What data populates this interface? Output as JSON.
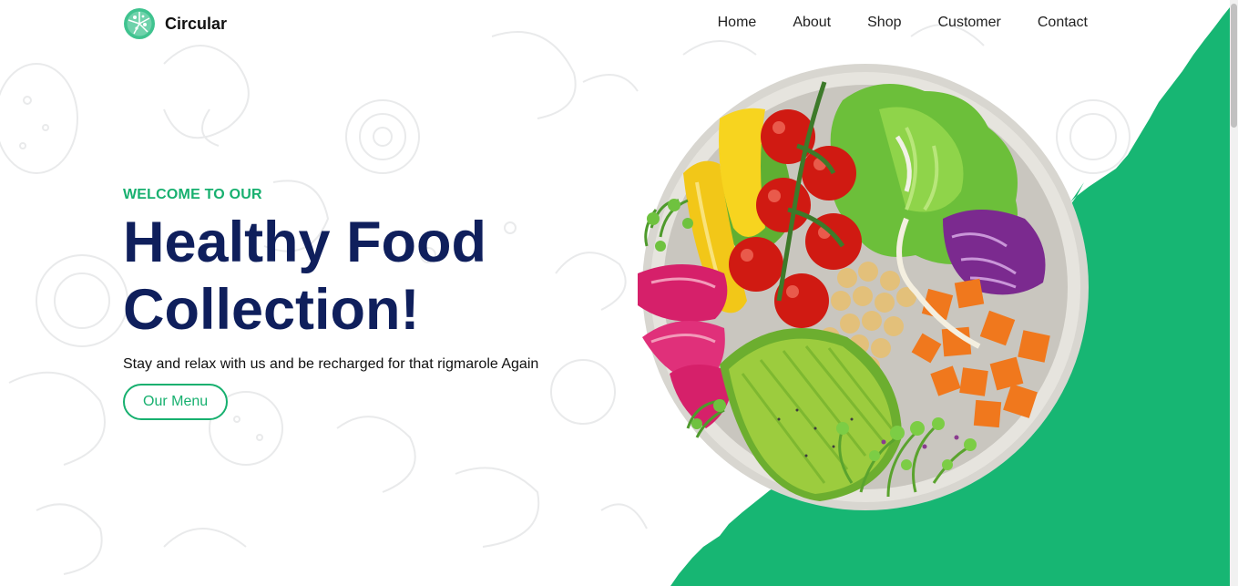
{
  "brand": {
    "name": "Circular",
    "logo_icon": "pizza-icon"
  },
  "nav": {
    "items": [
      {
        "label": "Home"
      },
      {
        "label": "About"
      },
      {
        "label": "Shop"
      },
      {
        "label": "Customer"
      },
      {
        "label": "Contact"
      }
    ]
  },
  "hero": {
    "eyebrow": "WELCOME TO OUR",
    "title_line1": "Healthy Food",
    "title_line2": "Collection!",
    "subtitle": "Stay and relax with us and be recharged for that rigmarole Again",
    "button_label": "Our Menu",
    "image": "salad-bowl-image"
  },
  "colors": {
    "accent": "#17b06f",
    "headline": "#0f1f5c",
    "text": "#111111",
    "background": "#ffffff"
  }
}
